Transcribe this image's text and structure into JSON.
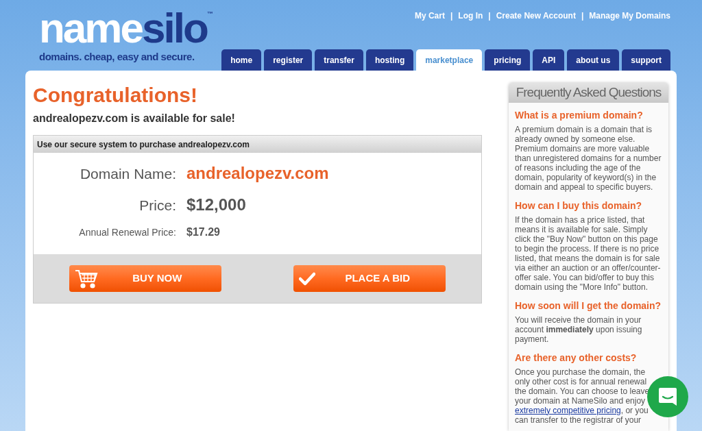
{
  "logo": {
    "word_a": "name",
    "word_b": "silo",
    "tm": "™",
    "tagline": "domains. cheap, easy and secure."
  },
  "top_links": [
    "My Cart",
    "Log In",
    "Create New Account",
    "Manage My Domains"
  ],
  "separator": "|",
  "tabs": [
    {
      "label": "home",
      "selected": false
    },
    {
      "label": "register",
      "selected": false
    },
    {
      "label": "transfer",
      "selected": false
    },
    {
      "label": "hosting",
      "selected": false
    },
    {
      "label": "marketplace",
      "selected": true
    },
    {
      "label": "pricing",
      "selected": false
    },
    {
      "label": "API",
      "selected": false
    },
    {
      "label": "about us",
      "selected": false
    },
    {
      "label": "support",
      "selected": false
    }
  ],
  "heading": "Congratulations!",
  "subheading": "andrealopezv.com is available for sale!",
  "purchase_box": {
    "title": "Use our secure system to purchase andrealopezv.com",
    "rows": [
      {
        "kind": "domain",
        "label": "Domain Name:",
        "value": "andrealopezv.com"
      },
      {
        "kind": "price",
        "label": "Price:",
        "value": "$12,000"
      },
      {
        "kind": "renewal",
        "label": "Annual Renewal Price:",
        "value": "$17.29"
      }
    ],
    "buttons": [
      {
        "kind": "cart",
        "label": "BUY NOW"
      },
      {
        "kind": "check",
        "label": "PLACE A BID"
      }
    ]
  },
  "faq": {
    "title": "Frequently Asked Questions",
    "items": [
      {
        "question": "What is a premium domain?",
        "answer": "A premium domain is a domain that is already owned by someone else. Premium domains are more valuable than unregistered domains for a number of reasons including the age of the domain, popularity of keyword(s) in the domain and appeal to specific buyers."
      },
      {
        "question": "How can I buy this domain?",
        "answer": "If the domain has a price listed, that means it is available for sale. Simply click the \"Buy Now\" button on this page to begin the process. If there is no price listed, that means the domain is for sale via either an auction or an offer/counter-offer sale. You can bid/offer to buy this domain using the \"More Info\" button."
      },
      {
        "question": "How soon will I get the domain?",
        "answer": "You will receive the domain in your account **immediately** upon issuing payment."
      },
      {
        "question": "Are there any other costs?",
        "lines": [
          {
            "text": "Once you purchase the domain, the"
          },
          {
            "text": "only other cost is for annual renewal"
          },
          {
            "text": "the domain. You can choose to leave"
          },
          {
            "text": "your domain at NameSilo and enjoy"
          },
          {
            "link": "extremely competitive pricing",
            "text": ", or you"
          },
          {
            "text": "can transfer to the registrar of your"
          }
        ]
      }
    ]
  }
}
